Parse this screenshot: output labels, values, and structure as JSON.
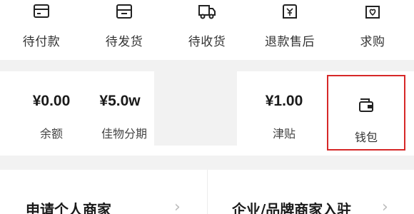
{
  "orders": [
    {
      "label": "待付款",
      "icon": "card-icon"
    },
    {
      "label": "待发货",
      "icon": "box-icon"
    },
    {
      "label": "待收货",
      "icon": "truck-icon"
    },
    {
      "label": "退款售后",
      "icon": "refund-icon"
    },
    {
      "label": "求购",
      "icon": "heart-bag-icon"
    }
  ],
  "assets": {
    "balance": {
      "value": "¥0.00",
      "label": "余额"
    },
    "installment": {
      "value": "¥5.0w",
      "label": "佳物分期"
    },
    "subsidy": {
      "value": "¥1.00",
      "label": "津贴"
    },
    "wallet": {
      "label": "钱包",
      "icon": "wallet-icon",
      "highlight_color": "#d62828"
    }
  },
  "merchant": {
    "personal": "申请个人商家",
    "brand": "企业/品牌商家入驻"
  }
}
